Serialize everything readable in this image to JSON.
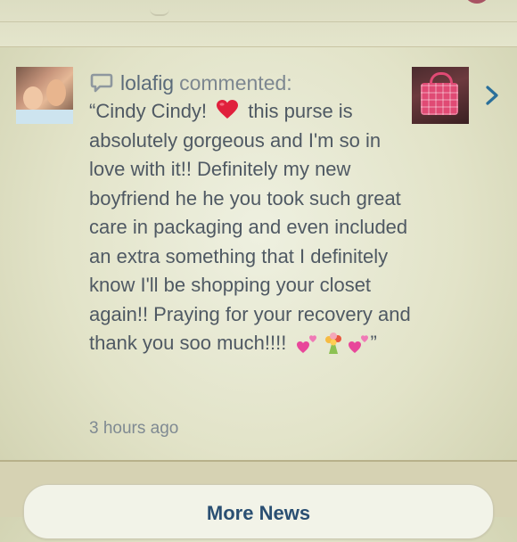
{
  "comment": {
    "username": "lolafig",
    "action": "commented:",
    "text_part1": "“Cindy Cindy!",
    "text_part2": "this purse is absolutely gorgeous and I'm so in love with it!! Definitely my new boyfriend he he you took such great care in packaging and even included an extra something that I definitely know I'll be shopping your closet again!! Praying for your recovery and thank you soo much!!!!",
    "text_close": "”",
    "timestamp": "3 hours ago"
  },
  "icons": {
    "comment": "speech-bubble-icon",
    "heart": "red-heart-emoji",
    "hearts": "two-hearts-emoji",
    "bouquet": "bouquet-emoji",
    "chevron": "chevron-right-icon"
  },
  "colors": {
    "username": "#5b6b7a",
    "body_text": "#4f5963",
    "accent_blue": "#2a6f9a",
    "heart_red": "#e0203c",
    "button_text": "#2a4f72"
  },
  "footer": {
    "more_button_label": "More News"
  }
}
